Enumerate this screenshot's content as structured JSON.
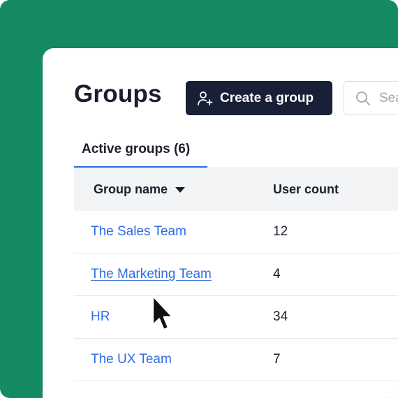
{
  "page": {
    "title": "Groups",
    "create_button_label": "Create a group",
    "search_placeholder": "Search"
  },
  "tabs": [
    {
      "label": "Active groups (6)",
      "active": true
    }
  ],
  "table": {
    "columns": [
      "Group name",
      "User count"
    ],
    "sort_column": "Group name",
    "rows": [
      {
        "name": "The Sales Team",
        "count": "12"
      },
      {
        "name": "The Marketing Team",
        "count": "4"
      },
      {
        "name": "HR",
        "count": "34"
      },
      {
        "name": "The UX Team",
        "count": "7"
      }
    ]
  },
  "colors": {
    "background": "#138a63",
    "button": "#172036",
    "link": "#2f6de1",
    "tab_underline": "#2f6de1",
    "header_row": "#f3f4f6"
  },
  "icons": {
    "create_button": "add-user-icon",
    "search": "search-icon",
    "sort": "caret-down-icon",
    "cursor": "mouse-pointer-icon"
  }
}
